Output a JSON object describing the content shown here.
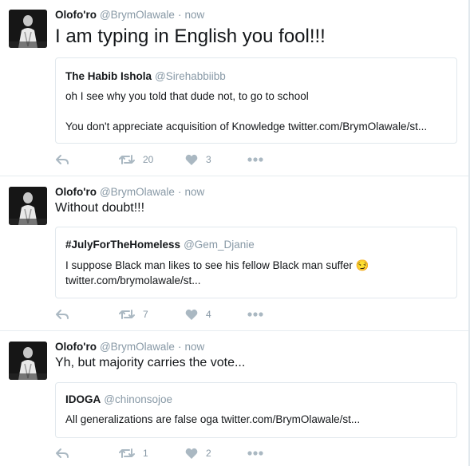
{
  "tweets": [
    {
      "author": {
        "name": "Olofo'ro",
        "handle": "@BrymOlawale"
      },
      "separator": "·",
      "time": "now",
      "text": "I am typing in English you fool!!!",
      "quote": {
        "name": "The Habib Ishola",
        "handle": "@Sirehabbiibb",
        "lines": [
          "oh I see why you told that dude not, to go to school",
          "You don't appreciate acquisition of Knowledge twitter.com/BrymOlawale/st..."
        ]
      },
      "actions": {
        "retweets": "20",
        "likes": "3"
      }
    },
    {
      "author": {
        "name": "Olofo'ro",
        "handle": "@BrymOlawale"
      },
      "separator": "·",
      "time": "now",
      "text": "Without doubt!!!",
      "quote": {
        "name": "#JulyForTheHomeless",
        "handle": "@Gem_Djanie",
        "lines": [
          "I suppose Black man likes to see his fellow Black man suffer 😏",
          "twitter.com/brymolawale/st..."
        ]
      },
      "actions": {
        "retweets": "7",
        "likes": "4"
      }
    },
    {
      "author": {
        "name": "Olofo'ro",
        "handle": "@BrymOlawale"
      },
      "separator": "·",
      "time": "now",
      "text": "Yh, but majority carries the vote...",
      "quote": {
        "name": "IDOGA",
        "handle": "@chinonsojoe",
        "lines": [
          "All generalizations are false oga twitter.com/BrymOlawale/st..."
        ]
      },
      "actions": {
        "retweets": "1",
        "likes": "2"
      }
    }
  ],
  "icons": {
    "reply": "reply-icon",
    "retweet": "retweet-icon",
    "like": "heart-icon",
    "more": "more-icon"
  },
  "colors": {
    "name": "#14171a",
    "muted": "#8899a6",
    "icon": "#aab8c2",
    "border": "#e1e8ed"
  }
}
